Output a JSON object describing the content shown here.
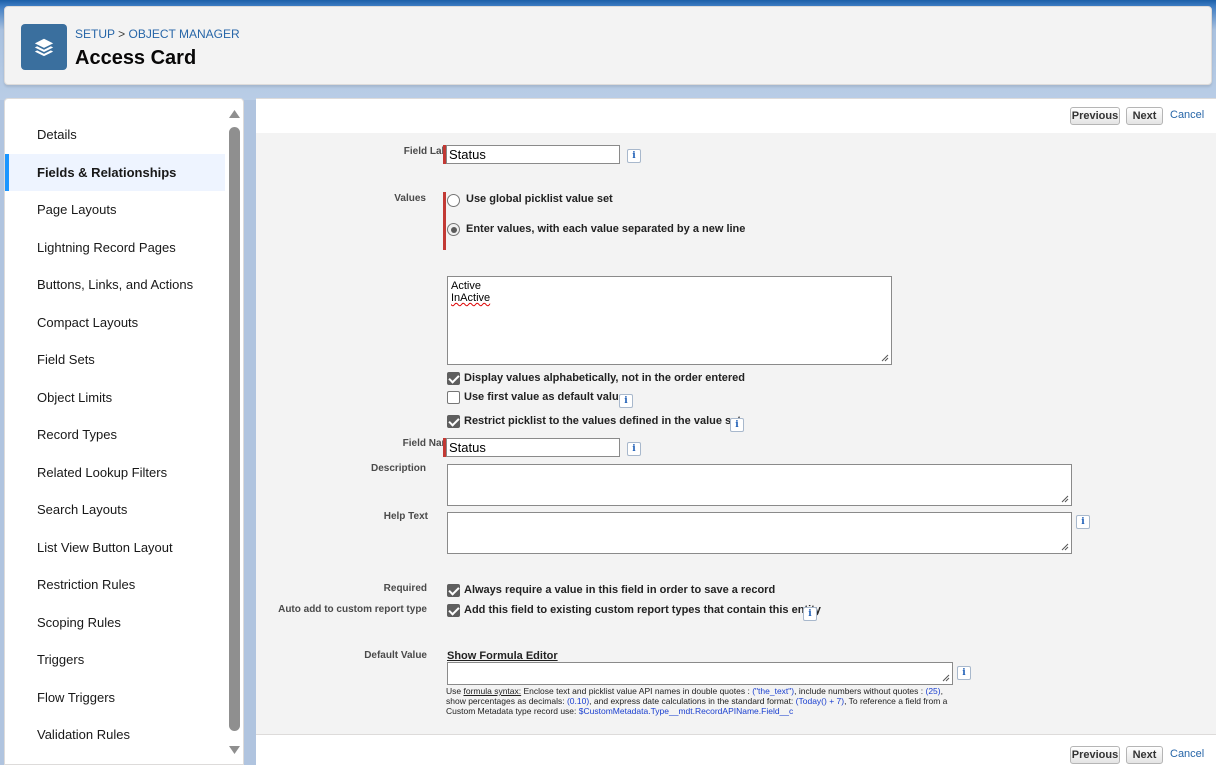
{
  "header": {
    "breadcrumb_setup": "SETUP",
    "breadcrumb_separator": ">",
    "breadcrumb_object_manager": "OBJECT MANAGER",
    "title": "Access Card",
    "icon": "layers-icon",
    "icon_color": "#3a6f9e"
  },
  "sidebar": {
    "active_color": "#1b96ff",
    "items": [
      {
        "label": "Details"
      },
      {
        "label": "Fields & Relationships",
        "active": true
      },
      {
        "label": "Page Layouts"
      },
      {
        "label": "Lightning Record Pages"
      },
      {
        "label": "Buttons, Links, and Actions"
      },
      {
        "label": "Compact Layouts"
      },
      {
        "label": "Field Sets"
      },
      {
        "label": "Object Limits"
      },
      {
        "label": "Record Types"
      },
      {
        "label": "Related Lookup Filters"
      },
      {
        "label": "Search Layouts"
      },
      {
        "label": "List View Button Layout"
      },
      {
        "label": "Restriction Rules"
      },
      {
        "label": "Scoping Rules"
      },
      {
        "label": "Triggers"
      },
      {
        "label": "Flow Triggers"
      },
      {
        "label": "Validation Rules"
      }
    ]
  },
  "buttons": {
    "previous": "Previous",
    "next": "Next",
    "cancel": "Cancel"
  },
  "form": {
    "field_label": {
      "label": "Field Label",
      "value": "Status"
    },
    "values": {
      "label": "Values",
      "option_global": "Use global picklist value set",
      "option_enter": "Enter values, with each value separated by a new line",
      "selected": "enter",
      "entries": [
        "Active",
        "InActive"
      ]
    },
    "checkboxes": {
      "alphabetical": {
        "label": "Display values alphabetically, not in the order entered",
        "checked": true
      },
      "first_default": {
        "label": "Use first value as default value",
        "checked": false
      },
      "restrict": {
        "label": "Restrict picklist to the values defined in the value set",
        "checked": true
      }
    },
    "field_name": {
      "label": "Field Name",
      "value": "Status"
    },
    "description": {
      "label": "Description",
      "value": ""
    },
    "help_text": {
      "label": "Help Text",
      "value": ""
    },
    "required": {
      "label": "Required",
      "text": "Always require a value in this field in order to save a record",
      "checked": true
    },
    "auto_add": {
      "label": "Auto add to custom report type",
      "text": "Add this field to existing custom report types that contain this entity",
      "checked": true
    },
    "default_value": {
      "label": "Default Value",
      "formula_link": "Show Formula Editor",
      "value": "",
      "hint": {
        "p1": "Use ",
        "p2": "formula syntax:",
        "p3": " Enclose text and picklist value API names in double quotes : ",
        "p4": "(\"the_text\")",
        "p5": ", include numbers without quotes : ",
        "p6": "(25)",
        "p7": ", show percentages as decimals: ",
        "p8": "(0.10)",
        "p9": ", and express date calculations in the standard format: ",
        "p10": "(Today() + 7)",
        "p11": ", To reference a field from a Custom Metadata type record use: ",
        "p12": "$CustomMetadata.Type__mdt.RecordAPIName.Field__c"
      }
    }
  }
}
